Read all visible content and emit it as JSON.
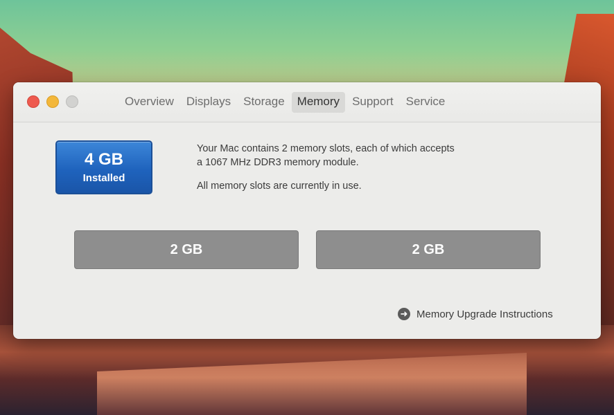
{
  "window": {
    "tabs": [
      {
        "label": "Overview"
      },
      {
        "label": "Displays"
      },
      {
        "label": "Storage"
      },
      {
        "label": "Memory"
      },
      {
        "label": "Support"
      },
      {
        "label": "Service"
      }
    ],
    "active_tab": "Memory"
  },
  "memory": {
    "total": "4 GB",
    "total_caption": "Installed",
    "description_line1": "Your Mac contains 2 memory slots, each of which accepts",
    "description_line2": "a 1067 MHz DDR3 memory module.",
    "status": "All memory slots are currently in use.",
    "slots": [
      {
        "size": "2 GB"
      },
      {
        "size": "2 GB"
      }
    ],
    "upgrade_link": "Memory Upgrade Instructions"
  },
  "colors": {
    "badge_blue": "#1f63bd",
    "slot_gray": "#8e8e8e",
    "close_red": "#ee5a4f",
    "minimize_yellow": "#f3b73a"
  }
}
